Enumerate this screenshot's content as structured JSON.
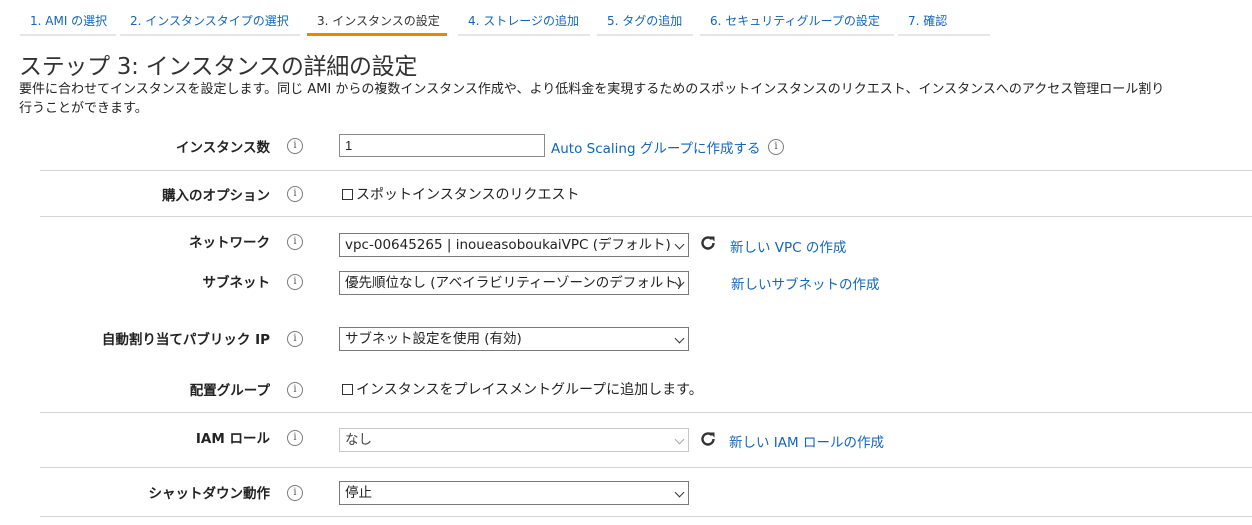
{
  "tabs": [
    {
      "label": "1. AMI の選択"
    },
    {
      "label": "2. インスタンスタイプの選択"
    },
    {
      "label": "3. インスタンスの設定"
    },
    {
      "label": "4. ストレージの追加"
    },
    {
      "label": "5. タグの追加"
    },
    {
      "label": "6. セキュリティグループの設定"
    },
    {
      "label": "7. 確認"
    }
  ],
  "page": {
    "title": "ステップ 3: インスタンスの詳細の設定",
    "description_line1": "要件に合わせてインスタンスを設定します。同じ AMI からの複数インスタンス作成や、より低料金を実現するためのスポットインスタンスのリクエスト、インスタンスへのアクセス管理ロール割り",
    "description_line2": "行うことができます。"
  },
  "fields": {
    "instance_count": {
      "label": "インスタンス数",
      "value": "1",
      "link": "Auto Scaling グループに作成する"
    },
    "purchase_option": {
      "label": "購入のオプション",
      "checkbox_label": "スポットインスタンスのリクエスト",
      "checked": false
    },
    "network": {
      "label": "ネットワーク",
      "selected": "vpc-00645265 | inoueasoboukaiVPC (デフォルト)",
      "link": "新しい VPC の作成"
    },
    "subnet": {
      "label": "サブネット",
      "selected": "優先順位なし (アベイラビリティーゾーンのデフォルト)",
      "link": "新しいサブネットの作成"
    },
    "auto_public_ip": {
      "label": "自動割り当てパブリック IP",
      "selected": "サブネット設定を使用 (有効)"
    },
    "placement_group": {
      "label": "配置グループ",
      "checkbox_label": "インスタンスをプレイスメントグループに追加します。",
      "checked": false
    },
    "iam_role": {
      "label": "IAM ロール",
      "selected": "なし",
      "link": "新しい IAM ロールの作成"
    },
    "shutdown_behavior": {
      "label": "シャットダウン動作",
      "selected": "停止"
    }
  },
  "colors": {
    "link": "#1166bb",
    "active_tab": "#e88800",
    "divider": "#d5d5d5"
  },
  "icons": [
    "info-icon",
    "refresh-icon",
    "chevron-down-icon"
  ]
}
